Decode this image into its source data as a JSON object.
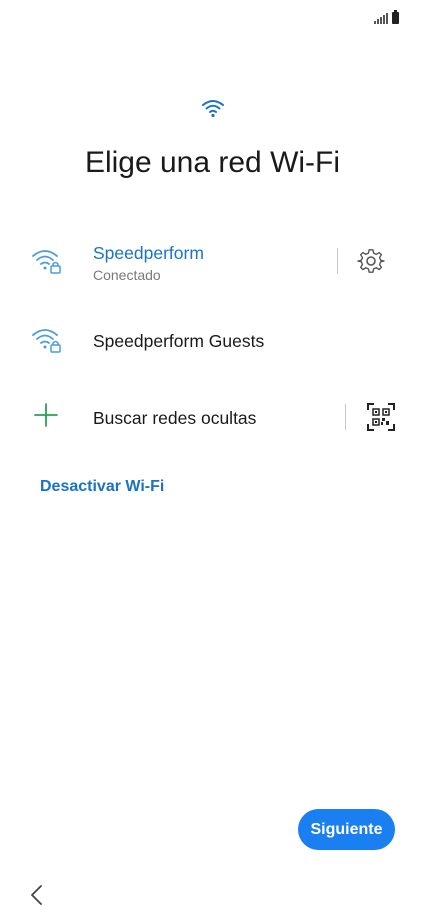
{
  "colors": {
    "accent": "#1a73c7",
    "button_bg": "#1a7ff0",
    "plus_green": "#2aa052",
    "secondary_text": "#7a7a7a"
  },
  "status_bar": {
    "icons": [
      "signal-icon",
      "battery-icon"
    ]
  },
  "header": {
    "icon": "wifi-icon",
    "title": "Elige una red Wi-Fi"
  },
  "networks": [
    {
      "name": "Speedperform",
      "status": "Conectado",
      "icon": "wifi-lock-icon",
      "trailing_icon": "settings-gear-icon",
      "connected": true
    },
    {
      "name": "Speedperform Guests",
      "icon": "wifi-lock-icon",
      "connected": false
    }
  ],
  "hidden_networks": {
    "label": "Buscar redes ocultas",
    "icon": "plus-icon",
    "trailing_icon": "qr-code-scan-icon"
  },
  "disable_wifi": {
    "label": "Desactivar Wi-Fi"
  },
  "footer": {
    "next_label": "Siguiente",
    "back_icon": "chevron-left-icon"
  }
}
